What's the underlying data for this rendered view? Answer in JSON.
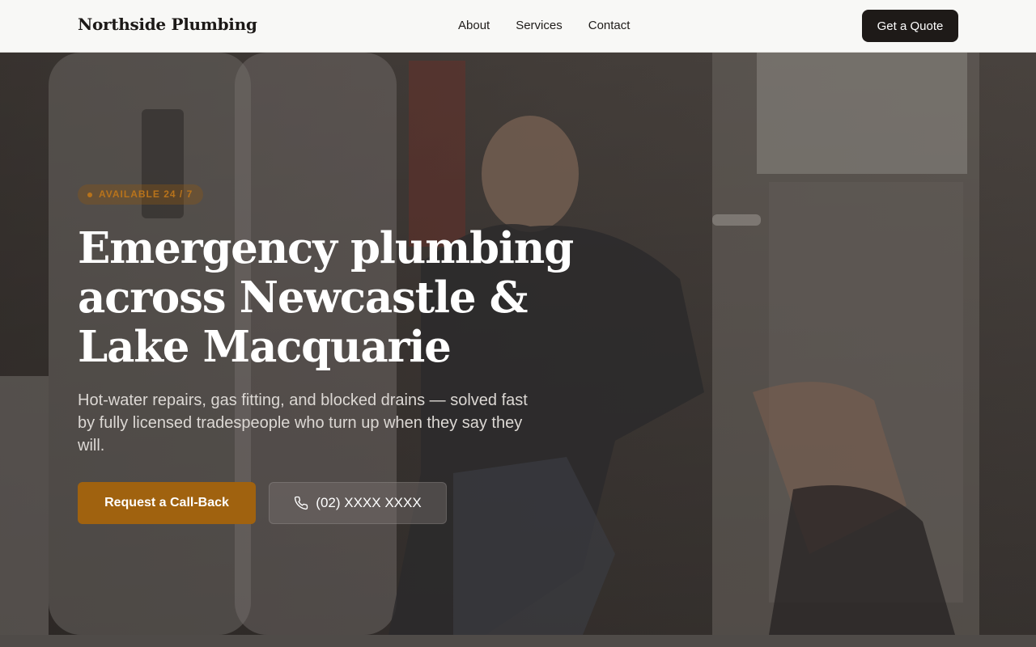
{
  "header": {
    "logo": "Northside Plumbing",
    "nav": [
      "About",
      "Services",
      "Contact"
    ],
    "cta_label": "Get a Quote"
  },
  "hero": {
    "badge": "AVAILABLE 24 / 7",
    "headline_lines": [
      "Emergency plumbing",
      "across Newcastle &",
      "Lake Macquarie"
    ],
    "subtext": "Hot-water repairs, gas fitting, and blocked drains — solved fast by fully licensed tradespeople who turn up when they say they will.",
    "primary_cta": "Request a Call-Back",
    "phone_cta": "(02) XXXX XXXX",
    "phone_icon": "phone-icon"
  },
  "colors": {
    "accent": "#a0620f",
    "badge_text": "#b8731b",
    "header_bg": "#f8f8f6",
    "dark": "#1e1a18"
  }
}
